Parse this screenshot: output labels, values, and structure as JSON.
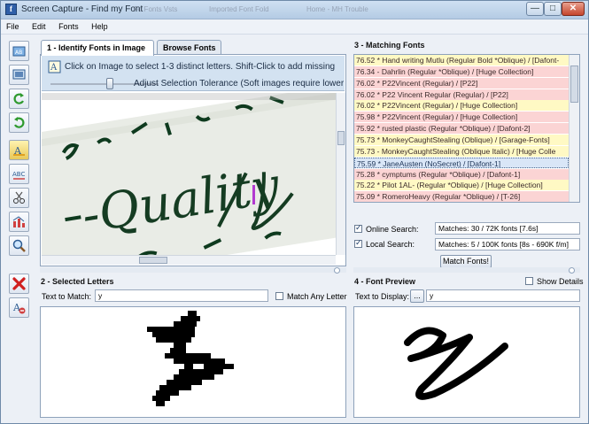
{
  "window": {
    "title": "Screen Capture - Find my Font",
    "background_tabs": [
      "Fo  Fonts Vsts",
      "Imported Font Fold",
      "Home - MH Trouble"
    ],
    "min": "—",
    "max": "□",
    "close": "✕"
  },
  "menu": [
    "File",
    "Edit",
    "Fonts",
    "Help"
  ],
  "panel1": {
    "title": "1 - Identify Fonts in Image",
    "tab_browse": "Browse Fonts",
    "hint": "Click on Image to select 1-3 distinct letters. Shift-Click to add missing",
    "tolerance_label": "Adjust Selection Tolerance (Soft images require lower",
    "tolerance_value": 0.55,
    "image_text": "-Quality"
  },
  "panel2": {
    "title": "2 - Selected Letters",
    "text_to_match_label": "Text to Match:",
    "text_to_match_value": "y",
    "match_any_label": "Match Any Letter",
    "match_any_checked": false
  },
  "panel3": {
    "title": "3 - Matching Fonts",
    "rows": [
      {
        "text": "76.52 * Hand writing Mutlu (Regular Bold *Oblique) / [Dafont-",
        "color": "yellow"
      },
      {
        "text": "76.34 - Dahrlin (Regular *Oblique) / [Huge Collection]",
        "color": "pink"
      },
      {
        "text": "76.02 * P22Vincent (Regular) / [P22]",
        "color": "pink"
      },
      {
        "text": "76.02 * P22 Vincent Regular (Regular) / [P22]",
        "color": "pink"
      },
      {
        "text": "76.02 * P22Vincent (Regular) / [Huge Collection]",
        "color": "yellow"
      },
      {
        "text": "75.98 * P22Vincent (Regular) / [Huge Collection]",
        "color": "pink"
      },
      {
        "text": "75.92 * rusted plastic (Regular *Oblique) / [Dafont-2]",
        "color": "pink"
      },
      {
        "text": "75.73 * MonkeyCaughtStealing (Oblique) / [Garage-Fonts]",
        "color": "yellow"
      },
      {
        "text": "75.73 - MonkeyCaughtStealing (Oblique Italic) / [Huge Colle",
        "color": "yellow"
      },
      {
        "text": "75.59 * JaneAusten (NoSecret) / [Dafont-1]",
        "color": "blue"
      },
      {
        "text": "75.28 * cymptums (Regular *Oblique) / [Dafont-1]",
        "color": "pink"
      },
      {
        "text": "75.22 * Pilot 1AL- (Regular *Oblique) / [Huge Collection]",
        "color": "yellow"
      },
      {
        "text": "75.09 * RomeroHeavy (Regular *Oblique) / [T-26]",
        "color": "pink"
      }
    ],
    "online_search_label": "Online Search:",
    "online_search_value": "Matches: 30 / 72K fonts [7.6s]",
    "local_search_label": "Local Search:",
    "local_search_value": "Matches: 5 / 100K fonts [8s - 690K f/m]",
    "match_button": "Match Fonts!",
    "online_checked": true,
    "local_checked": true
  },
  "panel4": {
    "title": "4 - Font Preview",
    "show_details_label": "Show Details",
    "show_details_checked": false,
    "text_to_display_label": "Text to Display:",
    "ellipsis_button": "...",
    "text_to_display_value": "y"
  },
  "colors": {
    "row_yellow": "#fff9c4",
    "row_pink": "#fbd4d4",
    "row_blue": "#d9e6f7",
    "accent": "#b23ad0"
  }
}
